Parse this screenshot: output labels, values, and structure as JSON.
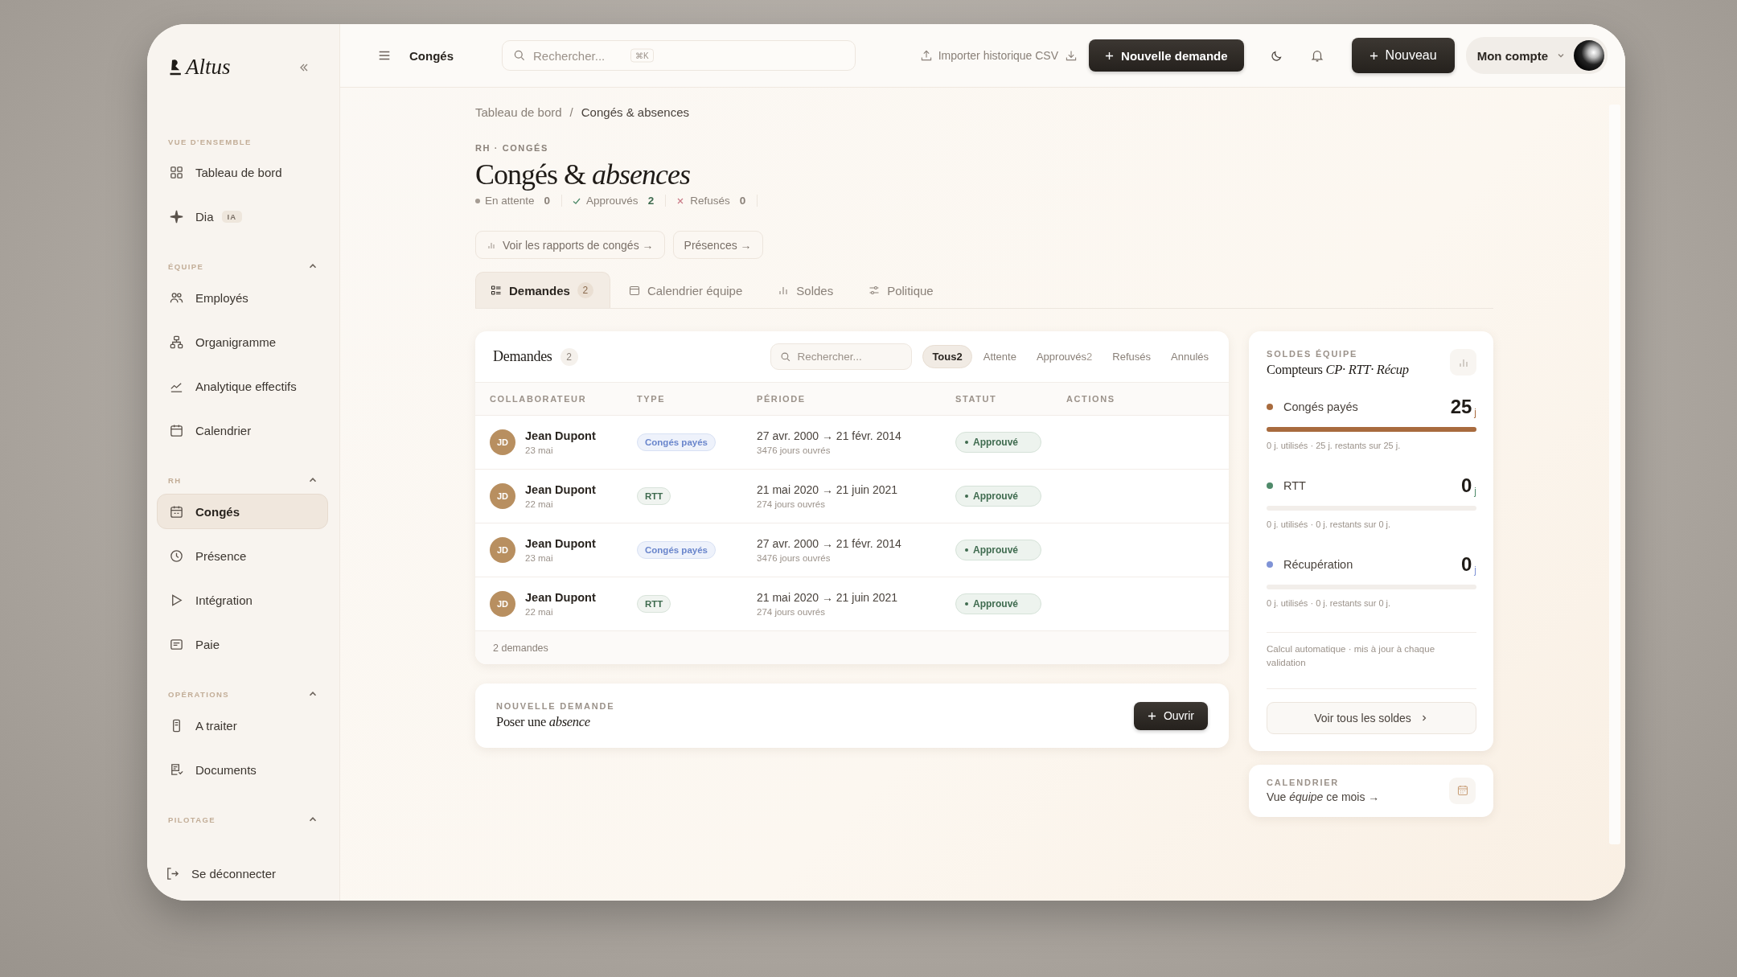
{
  "app": {
    "logo": "Altus"
  },
  "sidebar": {
    "sections": [
      {
        "label": "VUE D'ENSEMBLE",
        "items": [
          {
            "label": "Tableau de bord",
            "selected": false
          },
          {
            "label": "Dia",
            "badge": "IA",
            "selected": false
          }
        ]
      },
      {
        "label": "ÉQUIPE",
        "expanded": true,
        "items": [
          {
            "label": "Employés",
            "selected": false
          },
          {
            "label": "Organigramme",
            "selected": false
          },
          {
            "label": "Analytique effectifs",
            "selected": false
          },
          {
            "label": "Calendrier",
            "selected": false
          }
        ]
      },
      {
        "label": "RH",
        "expanded": true,
        "items": [
          {
            "label": "Congés",
            "selected": true
          },
          {
            "label": "Présence",
            "selected": false
          },
          {
            "label": "Intégration",
            "selected": false
          },
          {
            "label": "Paie",
            "selected": false
          }
        ]
      },
      {
        "label": "OPÉRATIONS",
        "expanded": true,
        "items": [
          {
            "label": "A traiter",
            "selected": false
          },
          {
            "label": "Documents",
            "selected": false
          }
        ]
      },
      {
        "label": "PILOTAGE",
        "expanded": true
      }
    ],
    "logout": "Se déconnecter"
  },
  "topbar": {
    "title": "Congés",
    "search": {
      "placeholder": "Rechercher...",
      "shortcut": "⌘K"
    },
    "import_button": "Importer historique CSV",
    "new_request_button": "Nouvelle demande",
    "new_button": "Nouveau",
    "account": "Mon compte"
  },
  "breadcrumb": [
    "Tableau de bord",
    "Congés & absences"
  ],
  "breadcrumb_separator": "/",
  "eyebrow": "RH · CONGÉS",
  "title": "Congés & *absences*",
  "stats": [
    {
      "kind": "pending",
      "label": "En attente",
      "value": "0"
    },
    {
      "kind": "approved",
      "label": "Approuvés",
      "value": "2"
    },
    {
      "kind": "refused",
      "label": "Refusés",
      "value": "0"
    }
  ],
  "links": [
    "Voir les rapports de congés →",
    "Présences →"
  ],
  "tabs": [
    {
      "label": "Demandes",
      "count": "2",
      "selected": true
    },
    {
      "label": "Calendrier équipe",
      "selected": false
    },
    {
      "label": "Soldes",
      "selected": false
    },
    {
      "label": "Politique",
      "selected": false
    }
  ],
  "requests": {
    "title": "Demandes",
    "count": "2",
    "search": {
      "placeholder": "Rechercher..."
    },
    "filters": [
      {
        "label": "Tous",
        "count": "2",
        "selected": true
      },
      {
        "label": "Attente",
        "selected": false
      },
      {
        "label": "Approuvés",
        "count": "2",
        "selected": false
      },
      {
        "label": "Refusés",
        "selected": false
      },
      {
        "label": "Annulés",
        "selected": false
      }
    ],
    "columns": [
      "COLLABORATEUR",
      "TYPE",
      "PÉRIODE",
      "STATUT",
      "ACTIONS"
    ],
    "rows": [
      {
        "initials": "JD",
        "name": "Jean Dupont",
        "date": "23 mai",
        "type": {
          "kind": "cp",
          "label": "Congés payés"
        },
        "period": "27 avr. 2000 → 21 févr. 2014",
        "days": "3476 jours ouvrés",
        "status": {
          "kind": "approved",
          "label": "Approuvé"
        }
      },
      {
        "initials": "JD",
        "name": "Jean Dupont",
        "date": "22 mai",
        "type": {
          "kind": "rtt",
          "label": "RTT"
        },
        "period": "21 mai 2020 → 21 juin 2021",
        "days": "274 jours ouvrés",
        "status": {
          "kind": "approved",
          "label": "Approuvé"
        }
      },
      {
        "initials": "JD",
        "name": "Jean Dupont",
        "date": "23 mai",
        "type": {
          "kind": "cp",
          "label": "Congés payés"
        },
        "period": "27 avr. 2000 → 21 févr. 2014",
        "days": "3476 jours ouvrés",
        "status": {
          "kind": "approved",
          "label": "Approuvé"
        }
      },
      {
        "initials": "JD",
        "name": "Jean Dupont",
        "date": "22 mai",
        "type": {
          "kind": "rtt",
          "label": "RTT"
        },
        "period": "21 mai 2020 → 21 juin 2021",
        "days": "274 jours ouvrés",
        "status": {
          "kind": "approved",
          "label": "Approuvé"
        }
      }
    ],
    "footer": "2 demandes"
  },
  "new_request": {
    "eyebrow": "NOUVELLE DEMANDE",
    "text": "Poser une *absence*",
    "button": "Ouvrir"
  },
  "balances": {
    "eyebrow": "SOLDES ÉQUIPE",
    "title": "Compteurs *CP· RTT· Récup*",
    "items": [
      {
        "name": "Congés payés",
        "color": "#a86b3e",
        "value": "25",
        "unit": "j",
        "level": 1,
        "detail": "0 j. utilisés · 25 j. restants sur 25 j."
      },
      {
        "name": "RTT",
        "color": "#4f8a6a",
        "value": "0",
        "unit": "j",
        "level": 0,
        "detail": "0 j. utilisés · 0 j. restants sur 0 j."
      },
      {
        "name": "Récupération",
        "color": "#7f93d6",
        "value": "0",
        "unit": "j",
        "level": 0,
        "detail": "0 j. utilisés · 0 j. restants sur 0 j."
      }
    ],
    "note": "Calcul automatique · mis à jour à chaque validation",
    "button": "Voir tous les soldes"
  },
  "calendar": {
    "eyebrow": "CALENDRIER",
    "text": "Vue *équipe* ce mois →"
  }
}
